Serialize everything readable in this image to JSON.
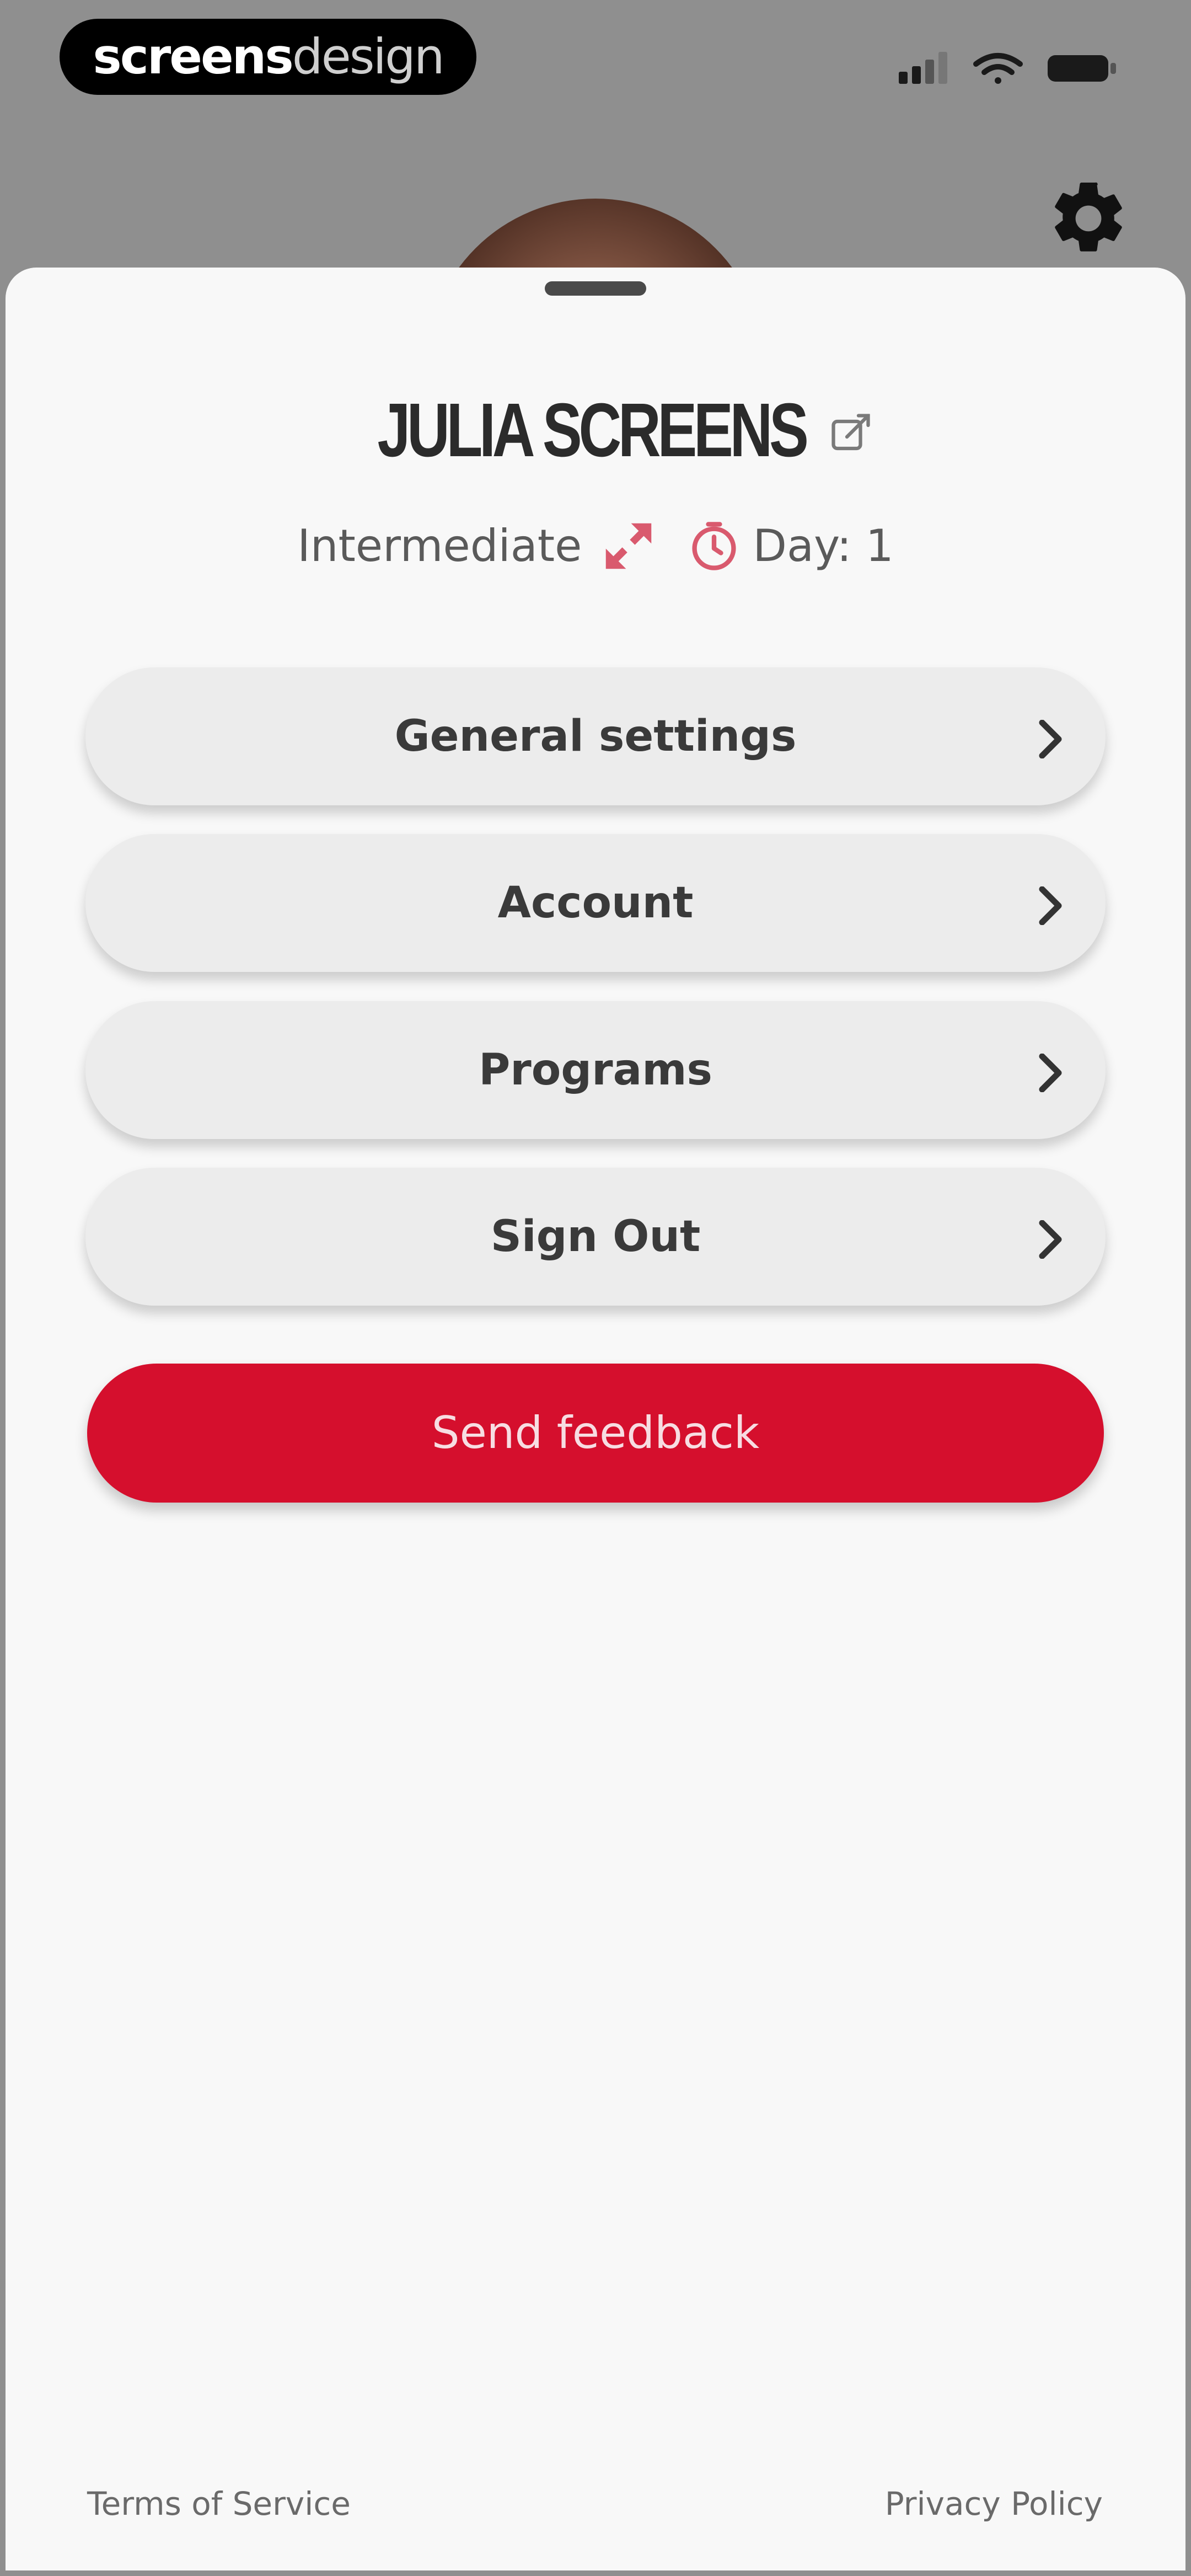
{
  "brand": {
    "part1": "screens",
    "part2": "design"
  },
  "profile": {
    "name": "JULIA SCREENS",
    "level": "Intermediate",
    "day": "Day: 1"
  },
  "menu": {
    "items": [
      {
        "label": "General settings"
      },
      {
        "label": "Account"
      },
      {
        "label": "Programs"
      },
      {
        "label": "Sign Out"
      }
    ]
  },
  "actions": {
    "feedback_label": "Send feedback"
  },
  "footer": {
    "terms": "Terms of Service",
    "privacy": "Privacy Policy"
  },
  "colors": {
    "accent": "#d50f2d",
    "sheet_bg": "#f8f8f8",
    "backdrop": "#8f8f8f",
    "menu_bg": "#ececec"
  },
  "icons": {
    "gear": "gear-icon",
    "edit": "edit-icon",
    "level": "expand-arrows-icon",
    "timer": "timer-icon",
    "chevron": "chevron-right-icon"
  }
}
